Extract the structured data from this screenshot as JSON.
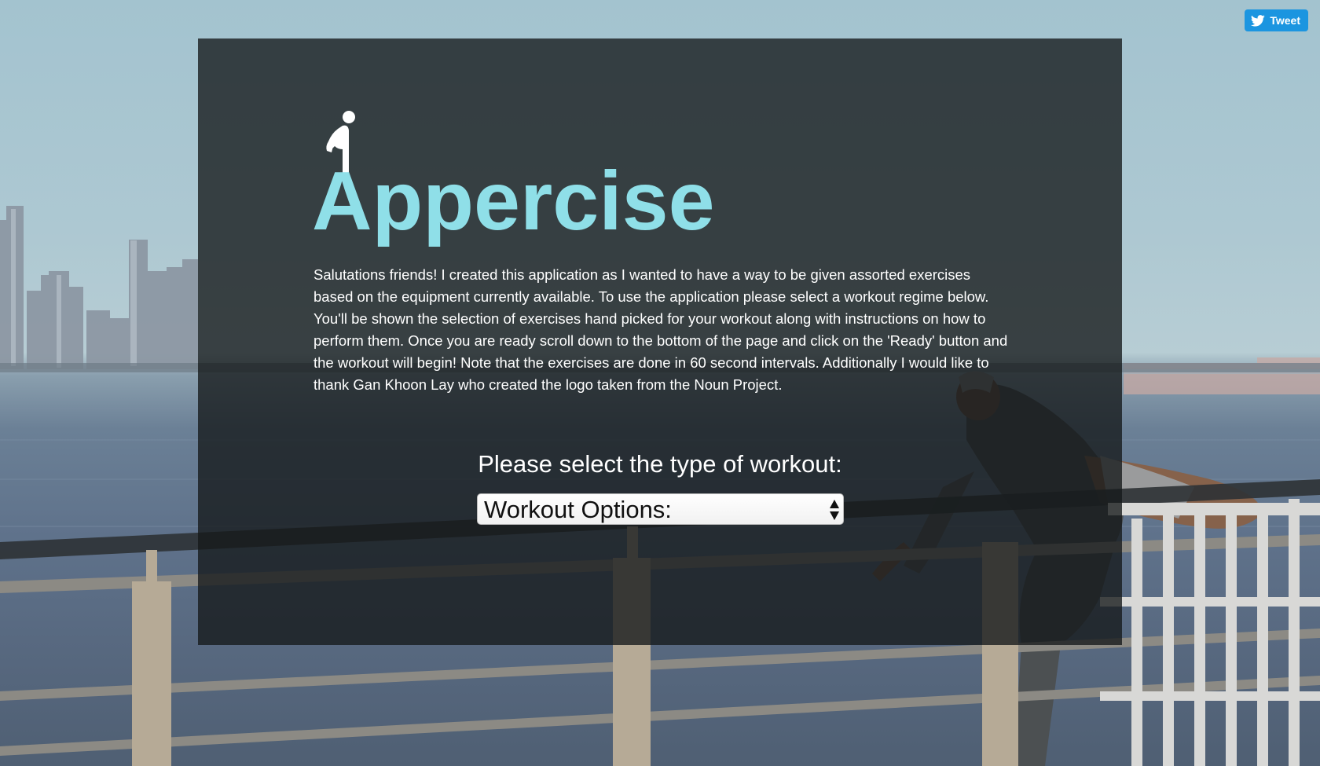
{
  "page": {
    "app_title": "Appercise",
    "intro_text": "Salutations friends! I created this application as I wanted to have a way to be given assorted exercises based on the equipment currently available. To use the application please select a workout regime below. You'll be shown the selection of exercises hand picked for your workout along with instructions on how to perform them. Once you are ready scroll down to the bottom of the page and click on the 'Ready' button and the workout will begin! Note that the exercises are done in 60 second intervals. Additionally I would like to thank Gan Khoon Lay who created the logo taken from the Noun Project.",
    "select_prompt": "Please select the type of workout:"
  },
  "workout_select": {
    "selected_value": "Workout Options:"
  },
  "tweet_button": {
    "label": "Tweet",
    "icon": "twitter-bird-icon"
  },
  "logo": {
    "icon": "person-stretching-icon"
  },
  "colors": {
    "title_accent": "#8fdfe8",
    "panel_overlay": "rgba(20,24,26,0.78)",
    "tweet_blue": "#1b95e0",
    "text": "#ffffff"
  }
}
